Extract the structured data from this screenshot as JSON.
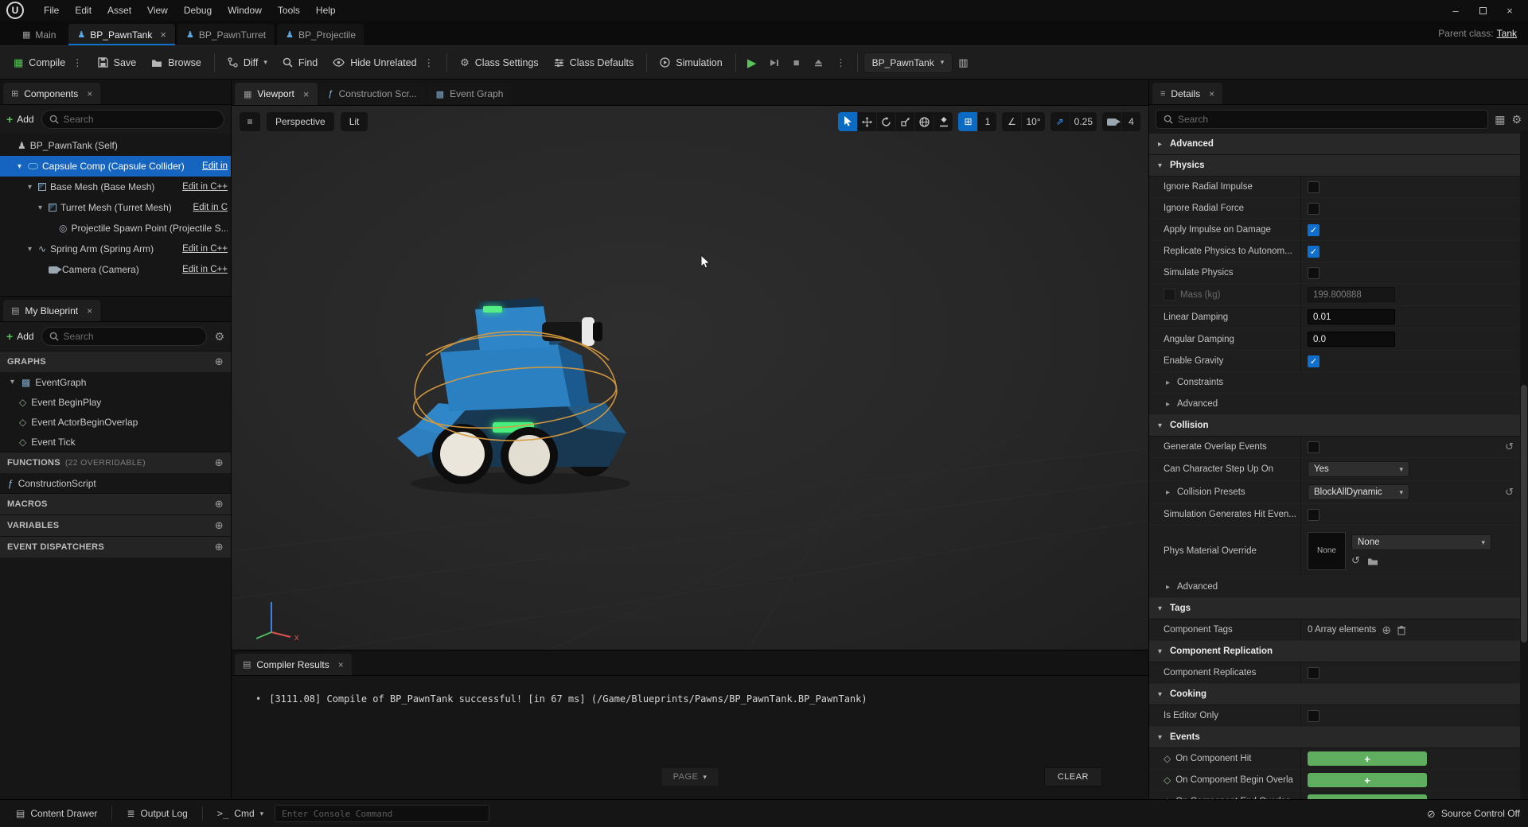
{
  "menubar": {
    "items": [
      "File",
      "Edit",
      "Asset",
      "View",
      "Debug",
      "Window",
      "Tools",
      "Help"
    ],
    "logo": "U"
  },
  "window": {
    "minimize": "–",
    "close": "×"
  },
  "tabbar": {
    "main_label": "Main",
    "doc_tabs": [
      {
        "label": "BP_PawnTank",
        "active": true
      },
      {
        "label": "BP_PawnTurret",
        "active": false
      },
      {
        "label": "BP_Projectile",
        "active": false
      }
    ],
    "parent_class_label": "Parent class:",
    "parent_class_value": "Tank"
  },
  "toolbar": {
    "compile": "Compile",
    "save": "Save",
    "browse": "Browse",
    "diff": "Diff",
    "find": "Find",
    "hide_unrelated": "Hide Unrelated",
    "class_settings": "Class Settings",
    "class_defaults": "Class Defaults",
    "simulation": "Simulation",
    "debug_target": "BP_PawnTank"
  },
  "components": {
    "title": "Components",
    "add": "Add",
    "search_placeholder": "Search",
    "tree": [
      {
        "label": "BP_PawnTank (Self)",
        "icon": "self",
        "depth": 0,
        "caret": false,
        "edit": "",
        "selected": false
      },
      {
        "label": "Capsule Comp (Capsule Collider)",
        "icon": "capsule",
        "depth": 1,
        "caret": true,
        "edit": "Edit in",
        "selected": true
      },
      {
        "label": "Base Mesh (Base Mesh)",
        "icon": "mesh",
        "depth": 2,
        "caret": true,
        "edit": "Edit in C++",
        "selected": false
      },
      {
        "label": "Turret Mesh (Turret Mesh)",
        "icon": "mesh",
        "depth": 3,
        "caret": true,
        "edit": "Edit in C",
        "selected": false
      },
      {
        "label": "Projectile Spawn Point (Projectile S...",
        "icon": "spawn",
        "depth": 4,
        "caret": false,
        "edit": "",
        "selected": false
      },
      {
        "label": "Spring Arm (Spring Arm)",
        "icon": "spring",
        "depth": 2,
        "caret": true,
        "edit": "Edit in C++",
        "selected": false
      },
      {
        "label": "Camera (Camera)",
        "icon": "camera",
        "depth": 3,
        "caret": false,
        "edit": "Edit in C++",
        "selected": false
      }
    ]
  },
  "my_blueprint": {
    "title": "My Blueprint",
    "add": "Add",
    "search_placeholder": "Search",
    "sections": [
      {
        "label": "GRAPHS",
        "sub": "",
        "rows": [
          {
            "label": "EventGraph",
            "icon": "graph",
            "depth": 0,
            "caret": true
          },
          {
            "label": "Event BeginPlay",
            "icon": "event",
            "depth": 1,
            "caret": false
          },
          {
            "label": "Event ActorBeginOverlap",
            "icon": "event",
            "depth": 1,
            "caret": false
          },
          {
            "label": "Event Tick",
            "icon": "event",
            "depth": 1,
            "caret": false
          }
        ]
      },
      {
        "label": "FUNCTIONS",
        "sub": "(22 OVERRIDABLE)",
        "rows": [
          {
            "label": "ConstructionScript",
            "icon": "function",
            "depth": 0,
            "caret": false
          }
        ]
      },
      {
        "label": "MACROS",
        "sub": "",
        "rows": []
      },
      {
        "label": "VARIABLES",
        "sub": "",
        "rows": []
      },
      {
        "label": "EVENT DISPATCHERS",
        "sub": "",
        "rows": []
      }
    ]
  },
  "viewport": {
    "tabs": [
      {
        "label": "Viewport"
      },
      {
        "label": "Construction Scr..."
      },
      {
        "label": "Event Graph"
      }
    ],
    "perspective": "Perspective",
    "lit": "Lit",
    "snap": {
      "grid": "1",
      "angle": "10°",
      "scale": "0.25",
      "camera": "4"
    },
    "axis_x": "x"
  },
  "compiler": {
    "title": "Compiler Results",
    "bullet": "•",
    "message": "[3111.08] Compile of BP_PawnTank successful! [in 67 ms] (/Game/Blueprints/Pawns/BP_PawnTank.BP_PawnTank)",
    "page": "PAGE",
    "clear": "CLEAR"
  },
  "details": {
    "title": "Details",
    "search_placeholder": "Search",
    "sections": [
      {
        "label": "Advanced",
        "collapsed": true,
        "rows": []
      },
      {
        "label": "Physics",
        "collapsed": false,
        "rows": [
          {
            "name": "Ignore Radial Impulse",
            "type": "checkbox",
            "checked": false
          },
          {
            "name": "Ignore Radial Force",
            "type": "checkbox",
            "checked": false
          },
          {
            "name": "Apply Impulse on Damage",
            "type": "checkbox",
            "checked": true
          },
          {
            "name": "Replicate Physics to Autonom...",
            "type": "checkbox",
            "checked": true
          },
          {
            "name": "Simulate Physics",
            "type": "checkbox",
            "checked": false
          },
          {
            "name": "Mass (kg)",
            "type": "mass",
            "value": "199.800888"
          },
          {
            "name": "Linear Damping",
            "type": "input",
            "value": "0.01"
          },
          {
            "name": "Angular Damping",
            "type": "input",
            "value": "0.0"
          },
          {
            "name": "Enable Gravity",
            "type": "checkbox",
            "checked": true
          },
          {
            "name": "Constraints",
            "type": "subsection"
          },
          {
            "name": "Advanced",
            "type": "subsection"
          }
        ]
      },
      {
        "label": "Collision",
        "collapsed": false,
        "rows": [
          {
            "name": "Generate Overlap Events",
            "type": "checkbox",
            "checked": false,
            "reset": true
          },
          {
            "name": "Can Character Step Up On",
            "type": "dropdown",
            "value": "Yes"
          },
          {
            "name": "Collision Presets",
            "type": "dropdown",
            "value": "BlockAllDynamic",
            "caret": true,
            "reset": true
          },
          {
            "name": "Simulation Generates Hit Even...",
            "type": "checkbox",
            "checked": false
          },
          {
            "name": "Phys Material Override",
            "type": "asset",
            "thumb_label": "None",
            "value": "None"
          },
          {
            "name": "Advanced",
            "type": "subsection"
          }
        ]
      },
      {
        "label": "Tags",
        "collapsed": false,
        "rows": [
          {
            "name": "Component Tags",
            "type": "array",
            "value": "0 Array elements"
          }
        ]
      },
      {
        "label": "Component Replication",
        "collapsed": false,
        "rows": [
          {
            "name": "Component Replicates",
            "type": "checkbox",
            "checked": false
          }
        ]
      },
      {
        "label": "Cooking",
        "collapsed": false,
        "rows": [
          {
            "name": "Is Editor Only",
            "type": "checkbox",
            "checked": false
          }
        ]
      },
      {
        "label": "Events",
        "collapsed": false,
        "rows": [
          {
            "name": "On Component Hit",
            "type": "event"
          },
          {
            "name": "On Component Begin Overla",
            "type": "event"
          },
          {
            "name": "On Component End Overlap",
            "type": "event"
          }
        ]
      }
    ]
  },
  "statusbar": {
    "content_drawer": "Content Drawer",
    "output_log": "Output Log",
    "cmd": "Cmd",
    "console_placeholder": "Enter Console Command",
    "source_control": "Source Control Off"
  }
}
